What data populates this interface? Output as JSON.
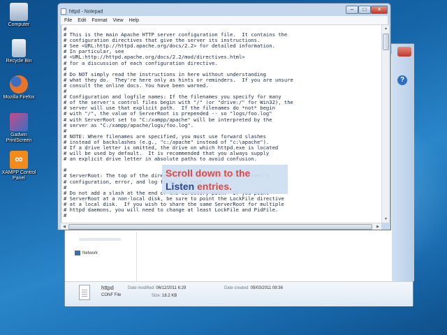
{
  "desktop": {
    "icons": [
      {
        "label": "Computer",
        "color": "#cfd8e6"
      },
      {
        "label": "Recycle Bin",
        "color": "#bcd0e2"
      },
      {
        "label": "Mozilla Firefox",
        "color": "#e8742a"
      },
      {
        "label": "Gadwin PrintScreen",
        "color": "#c74a8a"
      },
      {
        "label": "XAMPP Control Panel",
        "color": "#f28a1c"
      }
    ]
  },
  "explorer": {
    "nav_item": "Network",
    "file": {
      "name": "httpd",
      "type": "CONF File",
      "modified_label": "Date modified:",
      "modified_value": "06/12/2011 6:29",
      "created_label": "Date created:",
      "created_value": "09/03/2011 09:36",
      "size_label": "Size:",
      "size_value": "18.2 KB"
    }
  },
  "notepad": {
    "title": "httpd - Notepad",
    "menu": [
      "File",
      "Edit",
      "Format",
      "View",
      "Help"
    ],
    "content": "#\n# This is the main Apache HTTP server configuration file.  It contains the\n# configuration directives that give the server its instructions.\n# See <URL:http://httpd.apache.org/docs/2.2> for detailed information.\n# In particular, see\n# <URL:http://httpd.apache.org/docs/2.2/mod/directives.html>\n# for a discussion of each configuration directive.\n#\n# Do NOT simply read the instructions in here without understanding\n# what they do.  They're here only as hints or reminders.  If you are unsure\n# consult the online docs. You have been warned.\n#\n# Configuration and logfile names: If the filenames you specify for many\n# of the server's control files begin with \"/\" (or \"drive:/\" for Win32), the\n# server will use that explicit path.  If the filenames do *not* begin\n# with \"/\", the value of ServerRoot is prepended -- so \"logs/foo.log\"\n# with ServerRoot set to \"C:/xampp/apache\" will be interpreted by the\n# server as \"C:/xampp/apache/logs/foo.log\".\n#\n# NOTE: Where filenames are specified, you must use forward slashes\n# instead of backslashes (e.g., \"c:/apache\" instead of \"c:\\apache\").\n# If a drive letter is omitted, the drive on which httpd.exe is located\n# will be used by default.  It is recommended that you always supply\n# an explicit drive letter in absolute paths to avoid confusion.\n\n#\n# ServerRoot: The top of the directory tree under which the server's\n# configuration, error, and log files are kept.\n#\n# Do not add a slash at the end of the directory path.  If you point\n# ServerRoot at a non-local disk, be sure to point the LockFile directive\n# at a local disk.  If you wish to share the same ServerRoot for multiple\n# httpd daemons, you will need to change at least LockFile and PidFile.\n#"
  },
  "callout": {
    "line1": "Scroll down to the",
    "line2_blue": "Listen",
    "line2_red": " entries."
  }
}
